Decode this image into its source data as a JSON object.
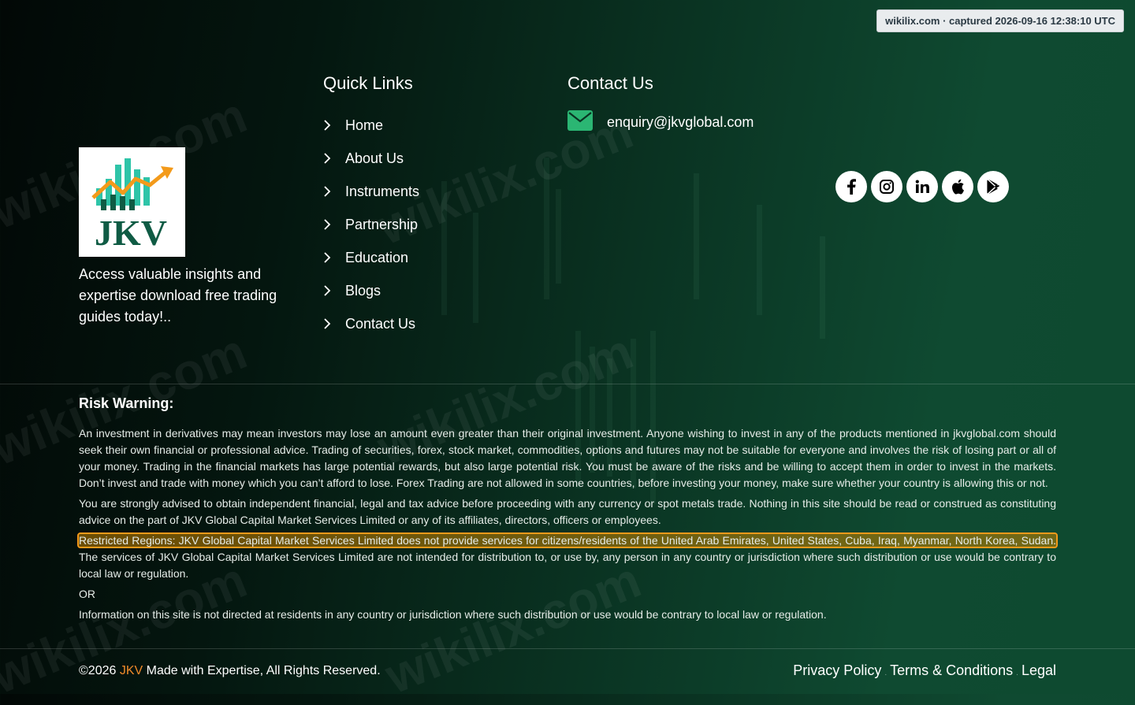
{
  "capture_badge": "wikilix.com · captured 2026-09-16 12:38:10 UTC",
  "watermark": "wikilix.com",
  "brand": {
    "logo_text": "JKV",
    "tagline": "Access valuable insights and expertise download free trading guides today!.."
  },
  "quick_links": {
    "title": "Quick Links",
    "items": [
      {
        "label": "Home"
      },
      {
        "label": "About Us"
      },
      {
        "label": "Instruments"
      },
      {
        "label": "Partnership"
      },
      {
        "label": "Education"
      },
      {
        "label": "Blogs"
      },
      {
        "label": "Contact Us"
      }
    ]
  },
  "contact": {
    "title": "Contact Us",
    "email": "enquiry@jkvglobal.com",
    "email_icon_color": "#2bb673"
  },
  "socials": [
    {
      "icon": "facebook-icon"
    },
    {
      "icon": "instagram-icon"
    },
    {
      "icon": "linkedin-icon"
    },
    {
      "icon": "apple-icon"
    },
    {
      "icon": "google-play-icon"
    }
  ],
  "risk": {
    "title": "Risk Warning:",
    "p1": "An investment in derivatives may mean investors may lose an amount even greater than their original investment. Anyone wishing to invest in any of the products mentioned in jkvglobal.com should seek their own financial or professional advice. Trading of securities, forex, stock market, commodities, options and futures may not be suitable for everyone and involves the risk of losing part or all of your money. Trading in the financial markets has large potential rewards, but also large potential risk. You must be aware of the risks and be willing to accept them in order to invest in the markets. Don’t invest and trade with money which you can’t afford to lose. Forex Trading are not allowed in some countries, before investing your money, make sure whether your country is allowing this or not.",
    "p2": "You are strongly advised to obtain independent financial, legal and tax advice before proceeding with any currency or spot metals trade. Nothing in this site should be read or construed as constituting advice on the part of JKV Global Capital Market Services Limited or any of its affiliates, directors, officers or employees.",
    "p3_highlight": "Restricted Regions: JKV Global Capital Market Services Limited does not provide services for citizens/residents of the United Arab Emirates, United States, Cuba, Iraq, Myanmar, North Korea, Sudan.",
    "p3_rest": " The services of JKV Global Capital Market Services Limited are not intended for distribution to, or use by, any person in any country or jurisdiction where such distribution or use would be contrary to local law or regulation.",
    "or": "OR",
    "p4": "Information on this site is not directed at residents in any country or jurisdiction where such distribution or use would be contrary to local law or regulation."
  },
  "footer": {
    "copyright_prefix": "©2026 ",
    "brand": "JKV",
    "copyright_suffix": " Made with Expertise, All Rights Reserved.",
    "links": [
      {
        "label": "Privacy Policy"
      },
      {
        "label": "Terms & Conditions"
      },
      {
        "label": "Legal"
      }
    ],
    "link_separator": "."
  },
  "colors": {
    "accent_orange": "#f08a2a",
    "logo_green": "#0f7a5a",
    "logo_teal": "#2ec4a8",
    "highlight_outline": "#f39a1a"
  }
}
